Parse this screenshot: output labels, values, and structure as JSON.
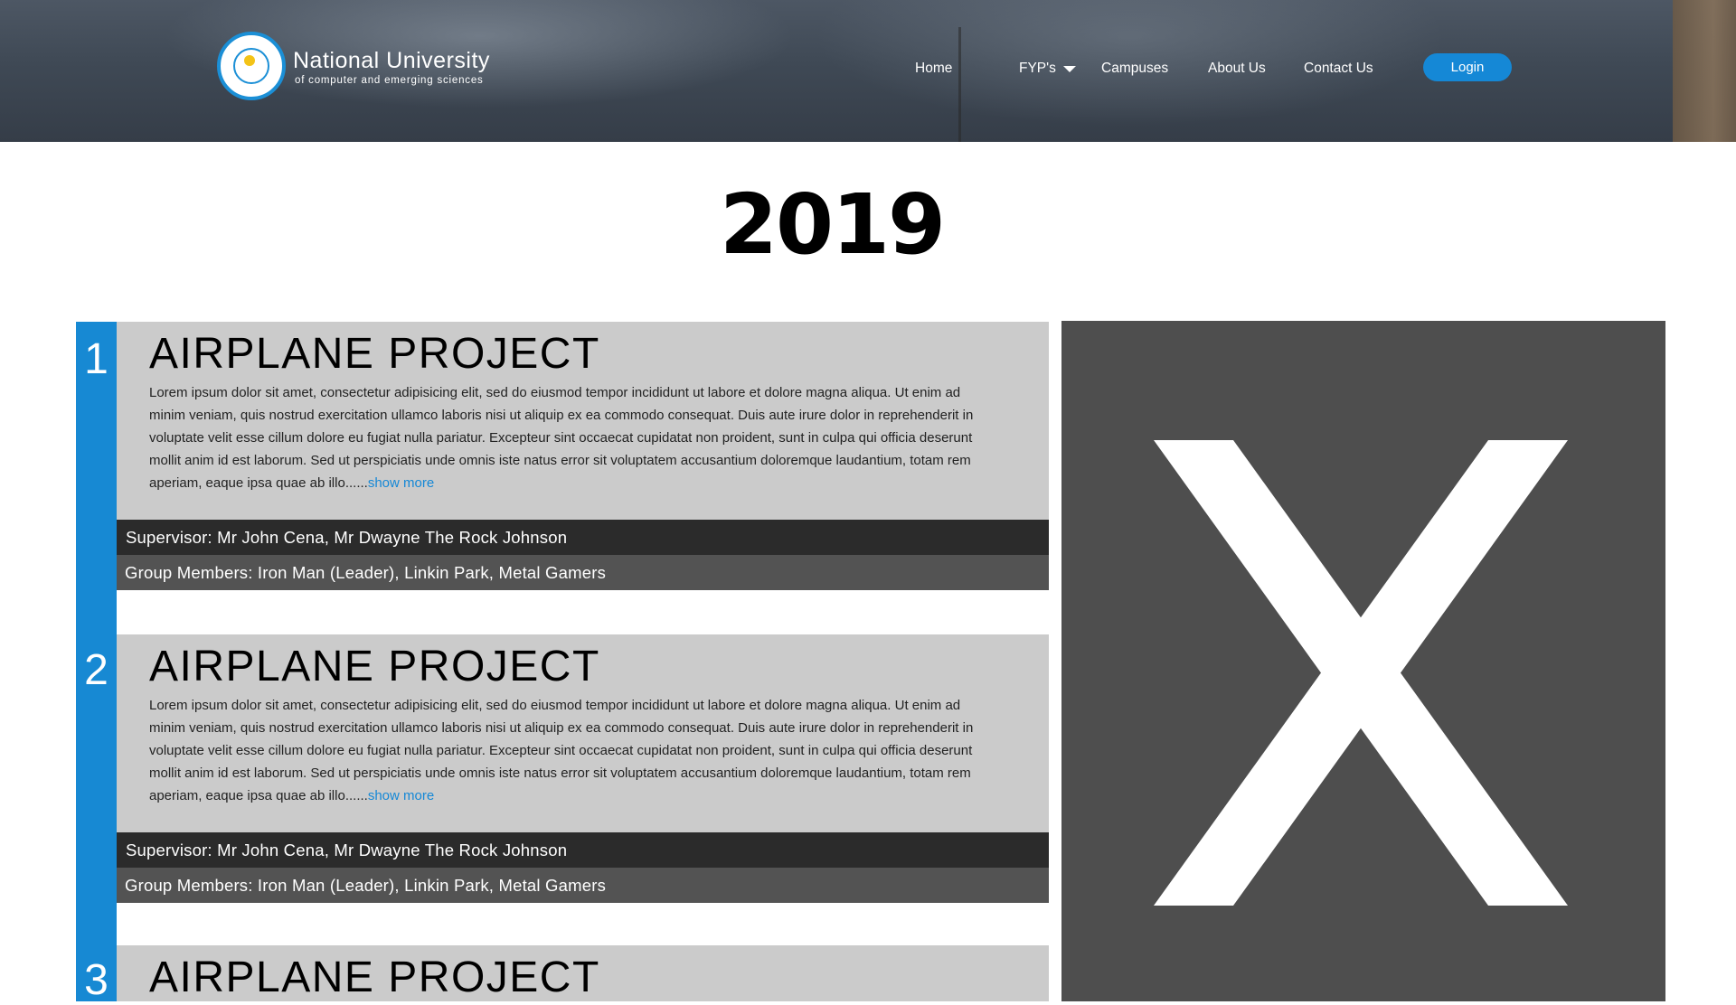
{
  "header": {
    "logo": {
      "title": "National University",
      "subtitle": "of computer and emerging sciences"
    },
    "nav": {
      "home": "Home",
      "fyps": "FYP's",
      "campuses": "Campuses",
      "about": "About Us",
      "contact": "Contact Us"
    },
    "login_label": "Login"
  },
  "year": "2019",
  "projects": [
    {
      "number": "1",
      "title": "AIRPLANE PROJECT",
      "description": "Lorem ipsum dolor sit amet, consectetur adipisicing elit, sed do eiusmod tempor incididunt ut labore et dolore magna aliqua. Ut enim ad minim veniam, quis nostrud exercitation ullamco laboris nisi ut aliquip ex ea commodo consequat. Duis aute irure dolor in reprehenderit in voluptate velit esse cillum dolore eu fugiat nulla pariatur. Excepteur sint occaecat cupidatat non proident, sunt in culpa qui officia deserunt mollit anim id est laborum. Sed ut perspiciatis unde omnis iste natus error sit voluptatem accusantium doloremque laudantium, totam rem aperiam, eaque ipsa quae ab illo......",
      "show_more": "show more",
      "supervisor": "Supervisor: Mr John Cena, Mr Dwayne The Rock Johnson",
      "members": "Group Members: Iron Man (Leader), Linkin Park, Metal Gamers"
    },
    {
      "number": "2",
      "title": "AIRPLANE PROJECT",
      "description": "Lorem ipsum dolor sit amet, consectetur adipisicing elit, sed do eiusmod tempor incididunt ut labore et dolore magna aliqua. Ut enim ad minim veniam, quis nostrud exercitation ullamco laboris nisi ut aliquip ex ea commodo consequat. Duis aute irure dolor in reprehenderit in voluptate velit esse cillum dolore eu fugiat nulla pariatur. Excepteur sint occaecat cupidatat non proident, sunt in culpa qui officia deserunt mollit anim id est laborum. Sed ut perspiciatis unde omnis iste natus error sit voluptatem accusantium doloremque laudantium, totam rem aperiam, eaque ipsa quae ab illo......",
      "show_more": "show more",
      "supervisor": "Supervisor: Mr John Cena, Mr Dwayne The Rock Johnson",
      "members": "Group Members: Iron Man (Leader), Linkin Park, Metal Gamers"
    },
    {
      "number": "3",
      "title": "AIRPLANE PROJECT"
    }
  ],
  "colors": {
    "accent": "#1789d3",
    "card": "#cbcbcb",
    "supervisor_row": "#2b2b2b",
    "members_row": "#535353",
    "image_placeholder": "#4e4e4e"
  },
  "icons": {
    "placeholder": "x-placeholder-icon",
    "dropdown": "caret-down-icon"
  }
}
